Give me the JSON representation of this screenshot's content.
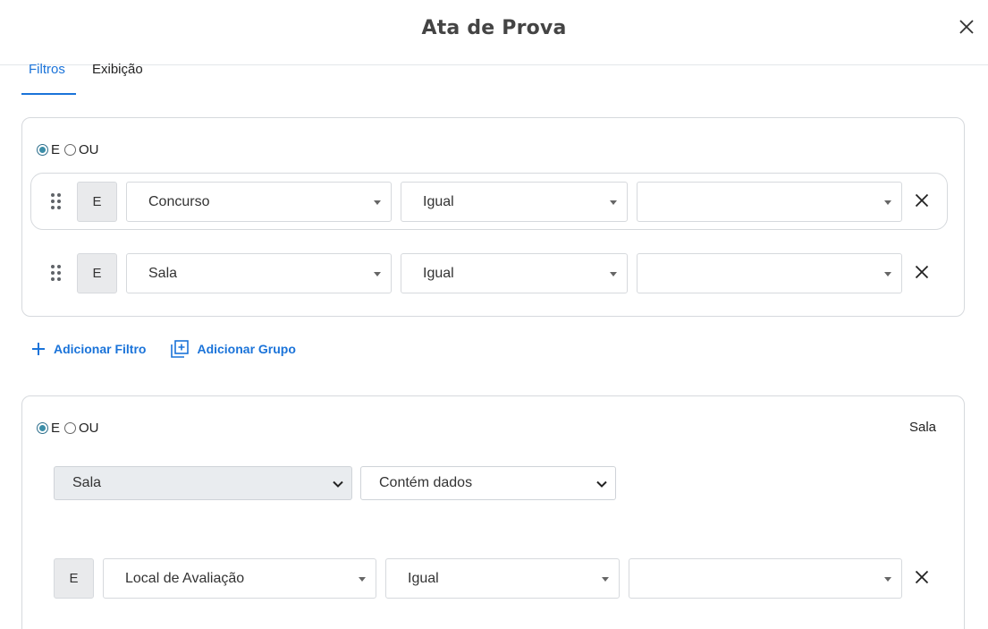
{
  "dialog": {
    "title": "Ata de Prova"
  },
  "tabs": [
    {
      "label": "Filtros"
    },
    {
      "label": "Exibição"
    }
  ],
  "logic": {
    "and_label": "E",
    "or_label": "OU"
  },
  "group1": {
    "rows": [
      {
        "conjunction": "E",
        "field": "Concurso",
        "operator": "Igual",
        "value": ""
      },
      {
        "conjunction": "E",
        "field": "Sala",
        "operator": "Igual",
        "value": ""
      }
    ]
  },
  "actions": {
    "add_filter": "Adicionar Filtro",
    "add_group": "Adicionar Grupo"
  },
  "group2": {
    "label": "Sala",
    "relation_field": "Sala",
    "relation_mode": "Contém dados",
    "rows": [
      {
        "conjunction": "E",
        "field": "Local de Avaliação",
        "operator": "Igual",
        "value": ""
      }
    ]
  },
  "colors": {
    "accent": "#1a73d9",
    "radio_checked": "#3c8ea8",
    "border": "#d6d9dd"
  }
}
